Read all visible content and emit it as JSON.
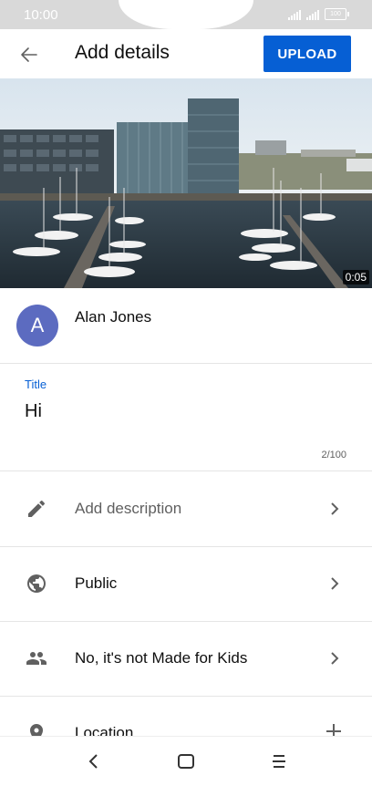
{
  "status_bar": {
    "time": "10:00",
    "battery": "100",
    "icons": [
      "signal-icon",
      "signal-icon",
      "battery-icon"
    ]
  },
  "app_bar": {
    "back_icon": "arrow-left-icon",
    "title": "Add details",
    "upload_label": "UPLOAD",
    "upload_color": "#065fd4"
  },
  "video": {
    "duration": "0:05"
  },
  "channel": {
    "avatar_letter": "A",
    "avatar_color": "#5c6bc0",
    "name": "Alan Jones"
  },
  "title_field": {
    "label": "Title",
    "value": "Hi",
    "counter": "2/100",
    "label_color": "#065fd4"
  },
  "options": [
    {
      "icon": "pencil-icon",
      "label": "Add description",
      "action": "chevron-right-icon"
    },
    {
      "icon": "globe-icon",
      "label": "Public",
      "action": "chevron-right-icon"
    },
    {
      "icon": "people-icon",
      "label": "No, it's not Made for Kids",
      "action": "chevron-right-icon"
    },
    {
      "icon": "location-pin-icon",
      "label": "Location",
      "action": "plus-icon"
    }
  ],
  "nav_bar": {
    "icons": [
      "back-chevron-icon",
      "home-square-icon",
      "menu-lines-icon"
    ]
  }
}
